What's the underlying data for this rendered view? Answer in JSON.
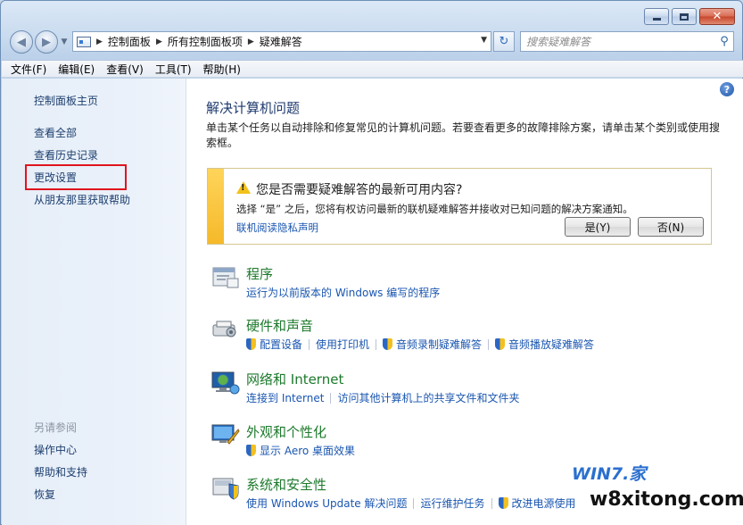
{
  "window": {
    "caption_buttons": {
      "minimize": "minimize",
      "maximize": "maximize",
      "close": "✕"
    }
  },
  "address_bar": {
    "segments": [
      "控制面板",
      "所有控制面板项",
      "疑难解答"
    ]
  },
  "search": {
    "placeholder": "搜索疑难解答"
  },
  "menu": [
    "文件(F)",
    "编辑(E)",
    "查看(V)",
    "工具(T)",
    "帮助(H)"
  ],
  "sidebar": {
    "home": "控制面板主页",
    "links": [
      "查看全部",
      "查看历史记录",
      "更改设置",
      "从朋友那里获取帮助"
    ],
    "see_also_heading": "另请参阅",
    "see_also": [
      "操作中心",
      "帮助和支持",
      "恢复"
    ]
  },
  "main": {
    "help": "?",
    "title": "解决计算机问题",
    "intro": "单击某个任务以自动排除和修复常见的计算机问题。若要查看更多的故障排除方案，请单击某个类别或使用搜索框。",
    "banner": {
      "heading": "您是否需要疑难解答的最新可用内容?",
      "text": "选择 “是” 之后，您将有权访问最新的联机疑难解答并接收对已知问题的解决方案通知。",
      "link": "联机阅读隐私声明",
      "yes": "是(Y)",
      "no": "否(N)"
    },
    "categories": [
      {
        "title": "程序",
        "links": [
          "运行为以前版本的 Windows 编写的程序"
        ]
      },
      {
        "title": "硬件和声音",
        "links": [
          "配置设备",
          "使用打印机",
          "音频录制疑难解答",
          "音频播放疑难解答"
        ]
      },
      {
        "title": "网络和 Internet",
        "links": [
          "连接到 Internet",
          "访问其他计算机上的共享文件和文件夹"
        ]
      },
      {
        "title": "外观和个性化",
        "links": [
          "显示 Aero 桌面效果"
        ]
      },
      {
        "title": "系统和安全性",
        "links": [
          "使用 Windows Update 解决问题",
          "运行维护任务",
          "改进电源使用"
        ]
      }
    ]
  },
  "watermark": {
    "logo": "WIN7.家",
    "site": "w8xitong.com"
  },
  "colors": {
    "category_title": "#1d7a2c",
    "link": "#1a56b0",
    "highlight": "#e0141e"
  }
}
